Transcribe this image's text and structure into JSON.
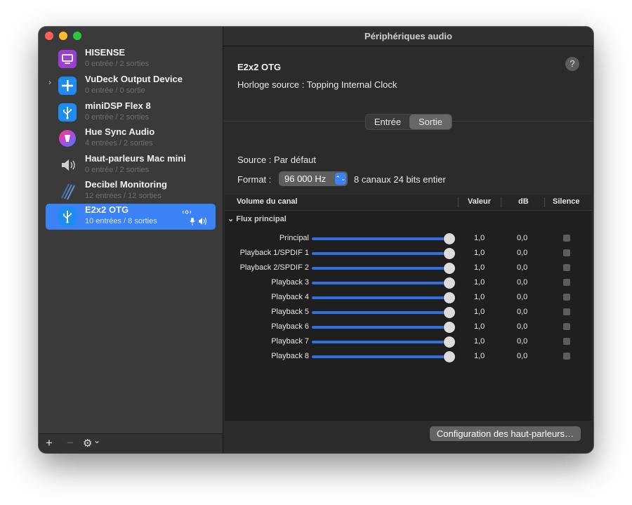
{
  "window": {
    "title": "Périphériques audio"
  },
  "devices": [
    {
      "name": "HISENSE",
      "sub": "0 entrée / 2 sorties",
      "icon": "tv-icon"
    },
    {
      "name": "VuDeck Output Device",
      "sub": "0 entrée / 0 sortie",
      "icon": "plus-icon"
    },
    {
      "name": "miniDSP Flex 8",
      "sub": "0 entrée / 2 sorties",
      "icon": "usb-icon"
    },
    {
      "name": "Hue Sync Audio",
      "sub": "4 entrées / 2 sorties",
      "icon": "hue-bulb-icon"
    },
    {
      "name": "Haut-parleurs Mac mini",
      "sub": "0 entrée / 2 sorties",
      "icon": "speaker-icon"
    },
    {
      "name": "Decibel Monitoring",
      "sub": "12 entrées / 12 sorties",
      "icon": "decibel-icon"
    },
    {
      "name": "E2x2 OTG",
      "sub": "10 entrées / 8 sorties",
      "icon": "usb-icon",
      "selected": true
    }
  ],
  "sidebar_footer": {
    "add": "+",
    "remove": "−",
    "gear": "⚙",
    "chevron": "⌄"
  },
  "detail": {
    "device_name": "E2x2 OTG",
    "clock_source": "Horloge source :  Topping Internal Clock",
    "help": "?",
    "tabs": [
      {
        "label": "Entrée",
        "active": false
      },
      {
        "label": "Sortie",
        "active": true
      }
    ],
    "source": "Source :  Par défaut",
    "format_label": "Format :",
    "format_value": "96 000 Hz",
    "format_desc": "8 canaux 24 bits entier"
  },
  "table": {
    "headers": {
      "channel": "Volume du canal",
      "value": "Valeur",
      "db": "dB",
      "mute": "Silence"
    },
    "group": "⌄  Flux principal",
    "rows": [
      {
        "name": "Principal",
        "value": "1,0",
        "db": "0,0",
        "level": 1.0,
        "muted": false
      },
      {
        "name": "Playback 1/SPDIF 1",
        "value": "1,0",
        "db": "0,0",
        "level": 1.0,
        "muted": false
      },
      {
        "name": "Playback 2/SPDIF 2",
        "value": "1,0",
        "db": "0,0",
        "level": 1.0,
        "muted": false
      },
      {
        "name": "Playback 3",
        "value": "1,0",
        "db": "0,0",
        "level": 1.0,
        "muted": false
      },
      {
        "name": "Playback 4",
        "value": "1,0",
        "db": "0,0",
        "level": 1.0,
        "muted": false
      },
      {
        "name": "Playback 5",
        "value": "1,0",
        "db": "0,0",
        "level": 1.0,
        "muted": false
      },
      {
        "name": "Playback 6",
        "value": "1,0",
        "db": "0,0",
        "level": 1.0,
        "muted": false
      },
      {
        "name": "Playback 7",
        "value": "1,0",
        "db": "0,0",
        "level": 1.0,
        "muted": false
      },
      {
        "name": "Playback 8",
        "value": "1,0",
        "db": "0,0",
        "level": 1.0,
        "muted": false
      }
    ]
  },
  "footer": {
    "speaker_config": "Configuration des haut-parleurs…"
  },
  "colors": {
    "accent": "#3b82f6",
    "slider": "#2f6fe0"
  }
}
